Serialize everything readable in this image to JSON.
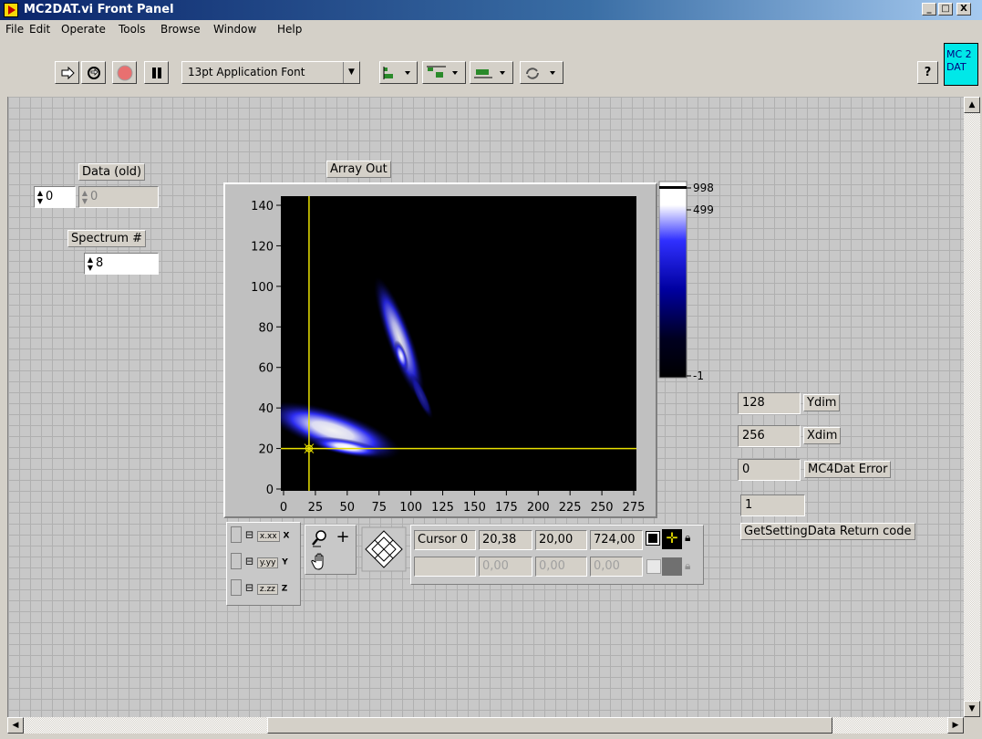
{
  "window": {
    "title": "MC2DAT.vi Front Panel",
    "buttons": [
      "_",
      "□",
      "X"
    ]
  },
  "menu": [
    "File",
    "Edit",
    "Operate",
    "Tools",
    "Browse",
    "Window",
    "Help"
  ],
  "menu_shortcuts": [
    "F",
    "E",
    "O",
    "T",
    "B",
    "W",
    "H"
  ],
  "toolbar": {
    "font": "13pt Application Font",
    "icon_names": [
      "run-arrow-icon",
      "run-continuous-icon",
      "abort-icon",
      "pause-icon",
      "align-icon",
      "distribute-icon",
      "resize-icon",
      "reorder-icon",
      "help-icon"
    ],
    "vi_icon": [
      "MC 2",
      "DAT"
    ]
  },
  "controls": {
    "data_old": {
      "label": "Data (old)",
      "index": "0",
      "value": "0"
    },
    "spectrum": {
      "label": "Spectrum #",
      "value": "8"
    },
    "ydim": {
      "value": "128",
      "label": "Ydim"
    },
    "xdim": {
      "value": "256",
      "label": "Xdim"
    },
    "mc4dat_error": {
      "value": "0",
      "label": "MC4Dat Error"
    },
    "getsetting": {
      "value": "1",
      "label": "GetSettingData Return code"
    }
  },
  "graph": {
    "label": "Array Out",
    "x_ticks": [
      "0",
      "25",
      "50",
      "75",
      "100",
      "125",
      "150",
      "175",
      "200",
      "225",
      "250",
      "275"
    ],
    "y_ticks": [
      "140",
      "120",
      "100",
      "80",
      "60",
      "40",
      "20",
      "0"
    ],
    "colorbar_ticks": [
      "998",
      "499",
      "-1"
    ],
    "cursor": {
      "x": 20,
      "y": 20
    }
  },
  "scale_palette": {
    "x_format": "x.xx",
    "y_format": "y.yy",
    "z_format": "z.zz",
    "axis_letters": [
      "X",
      "Y",
      "Z"
    ]
  },
  "cursor_palette": {
    "row1": {
      "name": "Cursor 0",
      "x": "20,38",
      "y": "20,00",
      "z": "724,00"
    },
    "row2": {
      "name": "",
      "x": "0,00",
      "y": "0,00",
      "z": "0,00"
    }
  },
  "colors": {
    "plot_bg": "#000000",
    "cursor": "#e8e000",
    "intensity_high": "#ffffff",
    "intensity_mid": "#2020ff"
  }
}
